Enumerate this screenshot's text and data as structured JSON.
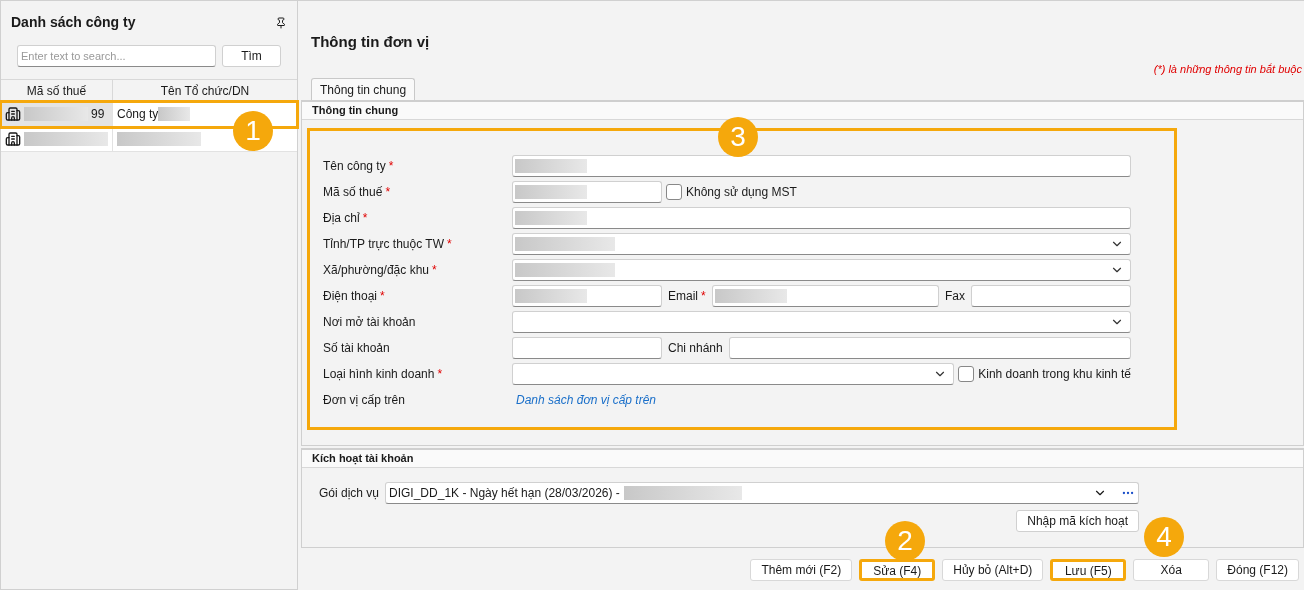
{
  "sidebar": {
    "title": "Danh sách công ty",
    "search": {
      "placeholder": "Enter text to search..."
    },
    "search_button": "Tìm",
    "columns": [
      "Mã số thuế",
      "Tên Tổ chức/DN"
    ],
    "rows": [
      {
        "tax_code": "99",
        "name": "Công ty",
        "selected": true
      },
      {
        "tax_code": "",
        "name": "",
        "selected": false
      }
    ]
  },
  "main": {
    "title": "Thông tin đơn vị",
    "required_note": "(*)  là những thông tin bắt buộc",
    "required_mark": "*",
    "tabs": [
      {
        "label": "Thông tin chung",
        "selected": true
      }
    ],
    "general": {
      "title": "Thông tin chung",
      "rows": [
        {
          "label": "Tên công ty",
          "required": true,
          "controls": [
            {
              "kind": "input",
              "redacted": true
            }
          ]
        },
        {
          "label": "Mã số thuế",
          "required": true,
          "controls": [
            {
              "kind": "input",
              "redacted": true
            },
            {
              "kind": "checkbox",
              "label": "Không sử dụng MST",
              "checked": false
            }
          ]
        },
        {
          "label": "Địa chỉ",
          "required": true,
          "controls": [
            {
              "kind": "input",
              "redacted": true
            }
          ]
        },
        {
          "label": "Tỉnh/TP trực thuộc TW",
          "required": true,
          "controls": [
            {
              "kind": "select",
              "redacted": true
            }
          ]
        },
        {
          "label": "Xã/phường/đặc khu",
          "required": true,
          "controls": [
            {
              "kind": "select",
              "redacted": true
            }
          ]
        },
        {
          "label": "Điện thoại",
          "required": true,
          "controls": [
            {
              "kind": "input",
              "redacted": true
            },
            {
              "kind": "label",
              "label": "Email",
              "required": true
            },
            {
              "kind": "input",
              "redacted": true
            },
            {
              "kind": "label",
              "label": "Fax",
              "required": false
            },
            {
              "kind": "input",
              "redacted": false
            }
          ]
        },
        {
          "label": "Nơi mở tài khoản",
          "required": false,
          "controls": [
            {
              "kind": "select",
              "redacted": false
            }
          ]
        },
        {
          "label": "Số tài khoản",
          "required": false,
          "controls": [
            {
              "kind": "input",
              "redacted": false
            },
            {
              "kind": "label",
              "label": "Chi nhánh",
              "required": false
            },
            {
              "kind": "input",
              "redacted": false
            }
          ]
        },
        {
          "label": "Loại hình kinh doanh",
          "required": true,
          "controls": [
            {
              "kind": "select",
              "redacted": false
            },
            {
              "kind": "checkbox",
              "label": "Kinh doanh trong khu kinh tế",
              "checked": false
            }
          ]
        },
        {
          "label": "Đơn vị cấp trên",
          "required": false,
          "controls": [
            {
              "kind": "link",
              "label": "Danh sách đơn vị cấp trên"
            }
          ]
        }
      ]
    },
    "activation": {
      "title": "Kích hoạt tài khoản",
      "service_label": "Gói dịch vụ",
      "service_value": "DIGI_DD_1K - Ngày hết hạn (28/03/2026) -",
      "activate_button": "Nhập mã kích hoạt"
    },
    "buttons": [
      {
        "label": "Thêm mới (F2)",
        "highlighted": false
      },
      {
        "label": "Sửa (F4)",
        "highlighted": true
      },
      {
        "label": "Hủy bỏ (Alt+D)",
        "highlighted": false
      },
      {
        "label": "Lưu (F5)",
        "highlighted": true
      },
      {
        "label": "Xóa",
        "highlighted": false
      },
      {
        "label": "Đóng (F12)",
        "highlighted": false
      }
    ]
  },
  "annotations": [
    "1",
    "2",
    "3",
    "4"
  ]
}
